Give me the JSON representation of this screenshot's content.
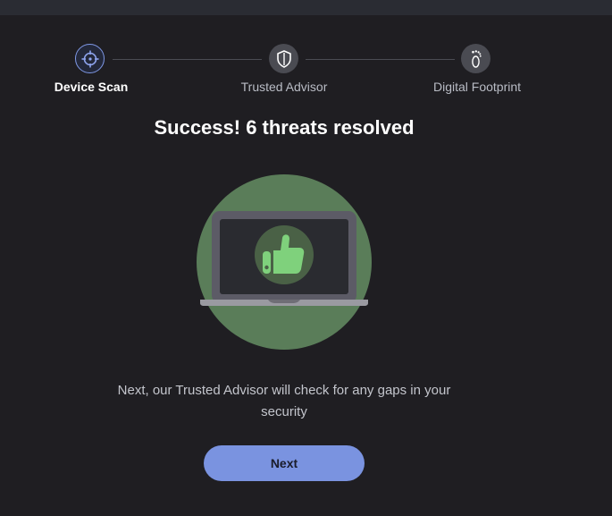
{
  "stepper": {
    "steps": [
      {
        "label": "Device Scan",
        "icon": "crosshair-icon",
        "state": "active"
      },
      {
        "label": "Trusted Advisor",
        "icon": "shield-icon",
        "state": "pending"
      },
      {
        "label": "Digital Footprint",
        "icon": "footprint-icon",
        "state": "pending"
      }
    ]
  },
  "main": {
    "title": "Success! 6 threats resolved",
    "illustration_icon": "laptop-thumbs-up-icon",
    "message": "Next, our Trusted Advisor will check for any gaps in your security",
    "next_label": "Next"
  },
  "colors": {
    "background": "#1f1e22",
    "accent": "#7a93e0",
    "success_circle": "#5a7d59",
    "thumb": "#7fd17c"
  }
}
